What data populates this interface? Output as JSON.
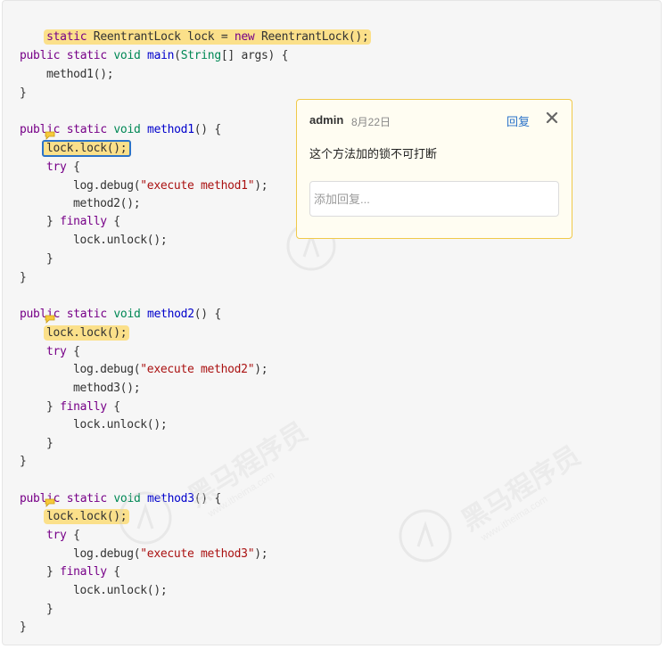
{
  "code": {
    "lines": [
      {
        "p1": "static ",
        "p2": "ReentrantLock",
        "p3": " lock = ",
        "p4": "new",
        "p5": " ReentrantLock();"
      },
      {
        "kw1": "public",
        "kw2": "static",
        "ty": "void",
        "fn": "main",
        "rest1": "(",
        "ty2": "String",
        "rest2": "[] args) {"
      },
      {
        "text": "method1();"
      },
      {
        "text": "}"
      },
      {
        "kw1": "public",
        "kw2": "static",
        "ty": "void",
        "fn": "method1",
        "rest": "() {"
      },
      {
        "text": "lock.lock();"
      },
      {
        "kw": "try",
        "rest": " {"
      },
      {
        "pre": "log.debug(",
        "str": "\"execute method1\"",
        "post": ");"
      },
      {
        "text": "method2();"
      },
      {
        "pre": "} ",
        "kw": "finally",
        "post": " {"
      },
      {
        "text": "lock.unlock();"
      },
      {
        "text": "}"
      },
      {
        "text": "}"
      },
      {
        "kw1": "public",
        "kw2": "static",
        "ty": "void",
        "fn": "method2",
        "rest": "() {"
      },
      {
        "text": "lock.lock();"
      },
      {
        "kw": "try",
        "rest": " {"
      },
      {
        "pre": "log.debug(",
        "str": "\"execute method2\"",
        "post": ");"
      },
      {
        "text": "method3();"
      },
      {
        "pre": "} ",
        "kw": "finally",
        "post": " {"
      },
      {
        "text": "lock.unlock();"
      },
      {
        "text": "}"
      },
      {
        "text": "}"
      },
      {
        "kw1": "public",
        "kw2": "static",
        "ty": "void",
        "fn": "method3",
        "rest": "() {"
      },
      {
        "text": "lock.lock();"
      },
      {
        "kw": "try",
        "rest": " {"
      },
      {
        "pre": "log.debug(",
        "str": "\"execute method3\"",
        "post": ");"
      },
      {
        "pre": "} ",
        "kw": "finally",
        "post": " {"
      },
      {
        "text": "lock.unlock();"
      },
      {
        "text": "}"
      },
      {
        "text": "}"
      }
    ]
  },
  "comment": {
    "author": "admin",
    "date": "8月22日",
    "reply_label": "回复",
    "text": "这个方法加的锁不可打断",
    "reply_placeholder": "添加回复..."
  },
  "watermark": {
    "brand": "黑马程序员",
    "url": "www.itheima.com"
  },
  "colors": {
    "highlight": "#fbe08a",
    "active_border": "#2b73c9",
    "comment_border": "#f0c94a",
    "keyword": "#770088",
    "type": "#008855",
    "function": "#0000cc",
    "string": "#aa1111"
  },
  "icons": {
    "comment_marker": "comment-marker-icon",
    "close": "close-icon",
    "watermark_logo": "itheima-logo-icon"
  }
}
